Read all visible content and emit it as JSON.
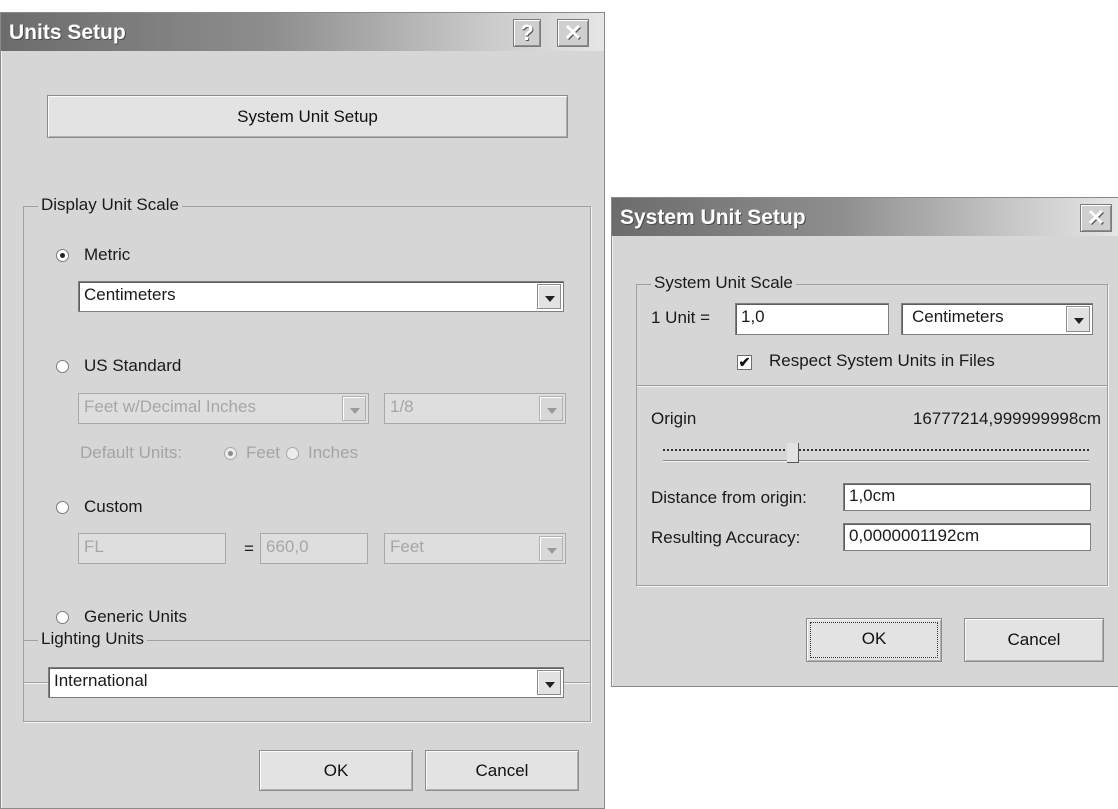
{
  "units_setup": {
    "title": "Units Setup",
    "help_icon": "question-mark-icon",
    "close_icon": "close-icon",
    "system_unit_setup_button": "System Unit Setup",
    "display_unit_scale": {
      "legend": "Display Unit Scale",
      "metric": {
        "label": "Metric",
        "selected": true,
        "dropdown": "Centimeters"
      },
      "us_standard": {
        "label": "US Standard",
        "selected": false,
        "units_dropdown": "Feet w/Decimal Inches",
        "fraction_dropdown": "1/8",
        "default_units_label": "Default Units:",
        "feet_label": "Feet",
        "feet_selected": true,
        "inches_label": "Inches",
        "inches_selected": false
      },
      "custom": {
        "label": "Custom",
        "selected": false,
        "name_value": "FL",
        "equals": "=",
        "amount_value": "660,0",
        "unit_dropdown": "Feet"
      },
      "generic": {
        "label": "Generic Units",
        "selected": false
      }
    },
    "lighting_units": {
      "legend": "Lighting Units",
      "dropdown": "International"
    },
    "ok_label": "OK",
    "cancel_label": "Cancel"
  },
  "system_unit_setup": {
    "title": "System Unit Setup",
    "close_icon": "close-icon",
    "scale_legend": "System Unit Scale",
    "one_unit_label": "1 Unit =",
    "one_unit_value": "1,0",
    "unit_dropdown": "Centimeters",
    "respect_label": "Respect System Units in Files",
    "respect_checked": true,
    "origin_label": "Origin",
    "origin_value": "16777214,999999998cm",
    "slider_position": 0.3,
    "distance_label": "Distance from origin:",
    "distance_value": "1,0cm",
    "accuracy_label": "Resulting Accuracy:",
    "accuracy_value": "0,0000001192cm",
    "ok_label": "OK",
    "cancel_label": "Cancel"
  }
}
